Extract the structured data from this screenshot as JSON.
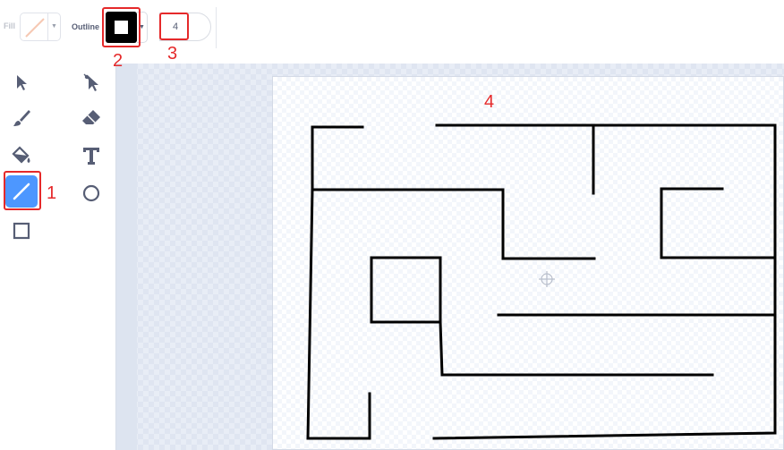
{
  "toolbar": {
    "fill_label": "Fill",
    "outline_label": "Outline",
    "outline_color": "#000000",
    "fill_color": "none",
    "stroke_width": "4"
  },
  "tools": [
    {
      "name": "select-tool",
      "icon": "arrow-cursor-icon"
    },
    {
      "name": "reshape-tool",
      "icon": "reshape-cursor-icon"
    },
    {
      "name": "brush-tool",
      "icon": "brush-icon"
    },
    {
      "name": "eraser-tool",
      "icon": "eraser-icon"
    },
    {
      "name": "fill-tool",
      "icon": "paint-bucket-icon"
    },
    {
      "name": "text-tool",
      "icon": "text-T-icon"
    },
    {
      "name": "line-tool",
      "icon": "line-icon",
      "active": true
    },
    {
      "name": "circle-tool",
      "icon": "circle-icon"
    },
    {
      "name": "rectangle-tool",
      "icon": "rectangle-icon"
    }
  ],
  "annotations": {
    "n1": "1",
    "n2": "2",
    "n3": "3",
    "n4": "4",
    "color": "#e5292a"
  },
  "colors": {
    "accent": "#4d97ff",
    "text": "#575e75"
  }
}
